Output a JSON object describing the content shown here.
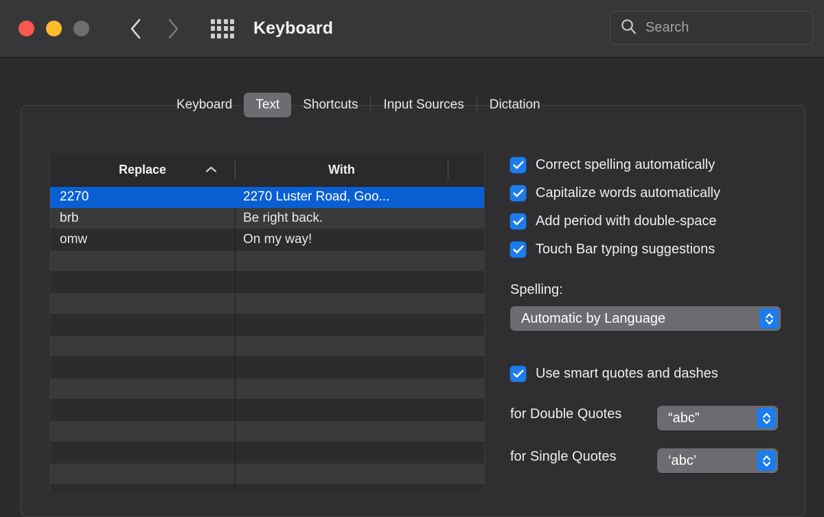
{
  "window": {
    "title": "Keyboard",
    "traffic_lights": [
      {
        "name": "close",
        "color": "#f8584f"
      },
      {
        "name": "minimize",
        "color": "#febb2d"
      },
      {
        "name": "zoom",
        "color": "#6e6e70"
      }
    ],
    "nav": {
      "back_icon": "chevron-left-icon",
      "forward_icon": "chevron-right-icon",
      "grid_icon": "show-all-grid-icon"
    }
  },
  "search": {
    "placeholder": "Search",
    "icon": "search-icon",
    "value": ""
  },
  "tabs": [
    {
      "label": "Keyboard",
      "selected": false
    },
    {
      "label": "Text",
      "selected": true
    },
    {
      "label": "Shortcuts",
      "selected": false
    },
    {
      "label": "Input Sources",
      "selected": false
    },
    {
      "label": "Dictation",
      "selected": false
    }
  ],
  "table": {
    "columns": [
      {
        "label": "Replace",
        "sorted": "ascending",
        "sort_icon": "chevron-up-icon"
      },
      {
        "label": "With",
        "sorted": "none"
      }
    ],
    "rows": [
      {
        "replace": "2270",
        "with": "2270 Luster Road, Goo...",
        "selected": true
      },
      {
        "replace": "brb",
        "with": "Be right back.",
        "selected": false
      },
      {
        "replace": "omw",
        "with": "On my way!",
        "selected": false
      }
    ],
    "empty_row_count": 12,
    "selection_color": "#0a5fd3"
  },
  "options": {
    "checkboxes": [
      {
        "label": "Correct spelling automatically",
        "checked": true
      },
      {
        "label": "Capitalize words automatically",
        "checked": true
      },
      {
        "label": "Add period with double-space",
        "checked": true
      },
      {
        "label": "Touch Bar typing suggestions",
        "checked": true
      }
    ],
    "spelling": {
      "label": "Spelling:",
      "value": "Automatic by Language"
    },
    "smart_quotes": {
      "label": "Use smart quotes and dashes",
      "checked": true,
      "double": {
        "label": "for Double Quotes",
        "value": "“abc”"
      },
      "single": {
        "label": "for Single Quotes",
        "value": "‘abc’"
      }
    }
  },
  "colors": {
    "accent": "#1d7cec",
    "selection": "#0a5fd3",
    "window_bg": "#2b2b2d",
    "titlebar_bg": "#37373a"
  }
}
